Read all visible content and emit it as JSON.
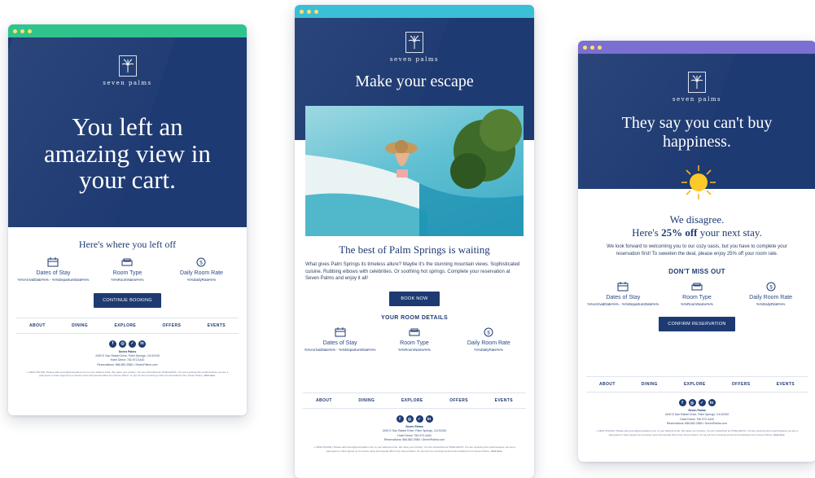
{
  "brand": {
    "name": "seven palms",
    "navy": "#1e3a72"
  },
  "cards": [
    {
      "bar_color": "#2fc48d",
      "headline": "You left an amazing view in your cart.",
      "section_title": "Here's where you left off",
      "details": [
        {
          "icon": "calendar-icon",
          "label": "Dates of Stay",
          "value": "%%ArrivalDate%% - %%DepartureDate%%"
        },
        {
          "icon": "bed-icon",
          "label": "Room Type",
          "value": "%%RoomName%%"
        },
        {
          "icon": "rate-icon",
          "label": "Daily Room Rate",
          "value": "%%DailyRate%%"
        }
      ],
      "button": "CONTINUE BOOKING"
    },
    {
      "bar_color": "#3bbfd6",
      "headline": "Make your escape",
      "section_title": "The best of Palm Springs is waiting",
      "paragraph": "What gives Palm Springs its timeless allure? Maybe it's the stunning mountain views. Sophisticated cuisine. Rubbing elbows with celebrities. Or soothing hot springs. Complete your reservation at Seven Palms and enjoy it all!",
      "button": "BOOK NOW",
      "subhead": "YOUR ROOM DETAILS",
      "details": [
        {
          "icon": "calendar-icon",
          "label": "Dates of Stay",
          "value": "%%ArrivalDate%% - %%DepartureDate%%"
        },
        {
          "icon": "bed-icon",
          "label": "Room Type",
          "value": "%%RoomName%%"
        },
        {
          "icon": "rate-icon",
          "label": "Daily Room Rate",
          "value": "%%DailyRate%%"
        }
      ]
    },
    {
      "bar_color": "#7b6fd1",
      "headline": "They say you can't buy happiness.",
      "disagree": "We disagree.",
      "offer_pre": "Here's ",
      "offer_bold": "25% off",
      "offer_post": " your next stay.",
      "paragraph": "We look forward to welcoming you to our cozy oasis, but you have to complete your reservation first! To sweeten the deal, please enjoy 25% off your room rate.",
      "subhead": "DON'T MISS OUT",
      "details": [
        {
          "icon": "calendar-icon",
          "label": "Dates of Stay",
          "value": "%%ArrivalDate%% - %%DepartureDate%%"
        },
        {
          "icon": "bed-icon",
          "label": "Room Type",
          "value": "%%RoomName%%"
        },
        {
          "icon": "rate-icon",
          "label": "Daily Room Rate",
          "value": "%%DailyRate%%"
        }
      ],
      "button": "CONFIRM RESERVATION"
    }
  ],
  "nav": [
    "ABOUT",
    "DINING",
    "EXPLORE",
    "OFFERS",
    "EVENTS"
  ],
  "footer": {
    "name": "Seven Palms",
    "address": "2400 E San Rafael Drive, Palm Springs, CA 92240",
    "hotel": "Hotel Direct: 760.972.4440",
    "reservations": "Reservations: 866.852.2580  •  SevenPalms.com",
    "fine": "» VIEW ONLINE | Please add seven@sevenpalms.com to your address book. We value your privacy. You are subscribed as %%Email%%. You are receiving this email because you are a past guest or have signed up to receive news and special offers from Seven Palms. To opt out from receiving email communications from Seven Palms,",
    "fine_link": "click here."
  }
}
